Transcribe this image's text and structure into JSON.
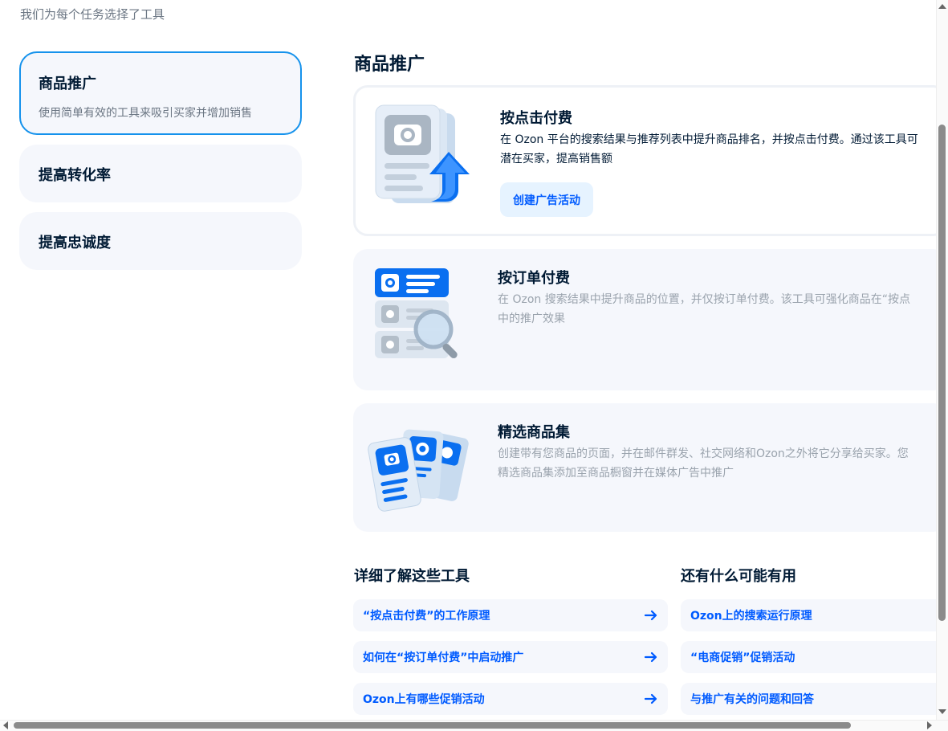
{
  "subtitle": "我们为每个任务选择了工具",
  "nav": [
    {
      "title": "商品推广",
      "desc": "使用简单有效的工具来吸引买家并增加销售",
      "active": true
    },
    {
      "title": "提高转化率"
    },
    {
      "title": "提高忠诚度"
    }
  ],
  "section_title": "商品推广",
  "cards": [
    {
      "title": "按点击付费",
      "desc_line1": "在 Ozon 平台的搜索结果与推荐列表中提升商品排名，并按点击付费。通过该工具可",
      "desc_line2": "潜在买家，提高销售额",
      "button": "创建广告活动"
    },
    {
      "title": "按订单付费",
      "desc_line1": "在 Ozon 搜索结果中提升商品的位置，并仅按订单付费。该工具可强化商品在“按点",
      "desc_line2": "中的推广效果"
    },
    {
      "title": "精选商品集",
      "desc_line1": "创建带有您商品的页面，并在邮件群发、社交网络和Ozon之外将它分享给买家。您",
      "desc_line2": "精选商品集添加至商品橱窗并在媒体广告中推广"
    }
  ],
  "learn": {
    "heading": "详细了解这些工具",
    "links": [
      "“按点击付费”的工作原理",
      "如何在“按订单付费”中启动推广",
      "Ozon上有哪些促销活动"
    ]
  },
  "useful": {
    "heading": "还有什么可能有用",
    "links": [
      "Ozon上的搜索运行原理",
      "“电商促销”促销活动",
      "与推广有关的问题和回答"
    ]
  },
  "colors": {
    "accent": "#005bff",
    "active_border": "#1592ec",
    "card_bg": "#f5f7fc"
  },
  "icons": [
    "camera-document-icon",
    "arrow-up-icon",
    "magnifier-list-icon",
    "photo-cards-icon",
    "arrow-right-icon"
  ]
}
